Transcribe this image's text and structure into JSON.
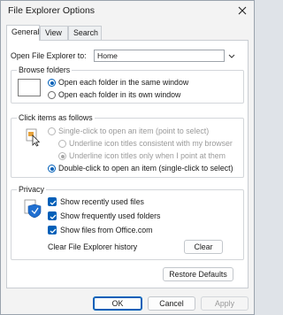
{
  "window": {
    "title": "File Explorer Options"
  },
  "tabs": [
    "General",
    "View",
    "Search"
  ],
  "open_to": {
    "label": "Open File Explorer to:",
    "value": "Home"
  },
  "browse_folders": {
    "title": "Browse folders",
    "options": [
      "Open each folder in the same window",
      "Open each folder in its own window"
    ]
  },
  "click_items": {
    "title": "Click items as follows",
    "single_click": "Single-click to open an item (point to select)",
    "underline_consistent": "Underline icon titles consistent with my browser",
    "underline_point": "Underline icon titles only when I point at them",
    "double_click": "Double-click to open an item (single-click to select)"
  },
  "privacy": {
    "title": "Privacy",
    "checks": [
      "Show recently used files",
      "Show frequently used folders",
      "Show files from Office.com"
    ],
    "clear_label": "Clear File Explorer history",
    "clear_button": "Clear"
  },
  "restore_defaults": "Restore Defaults",
  "footer": {
    "ok": "OK",
    "cancel": "Cancel",
    "apply": "Apply"
  },
  "colors": {
    "accent": "#005fb8"
  }
}
